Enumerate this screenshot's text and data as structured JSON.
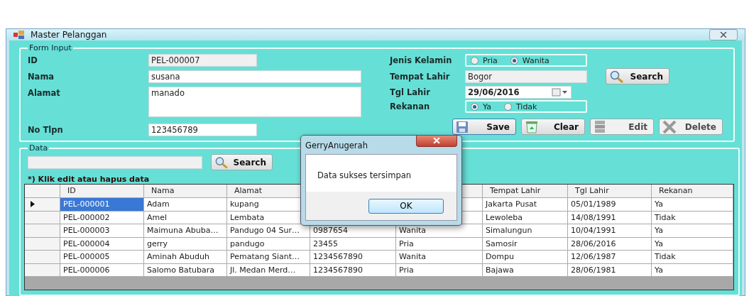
{
  "window": {
    "title": "Master Pelanggan"
  },
  "form_input": {
    "title": "Form Input",
    "left_fields": [
      {
        "label": "ID",
        "value": "PEL-000007",
        "kind": "readonly"
      },
      {
        "label": "Nama",
        "value": "susana",
        "kind": "text"
      },
      {
        "label": "Alamat",
        "value": "manado",
        "kind": "multiline"
      },
      {
        "label": "No Tlpn",
        "value": "123456789",
        "kind": "short"
      }
    ],
    "right_fields": [
      {
        "label": "Jenis Kelamin",
        "kind": "radio",
        "options": [
          {
            "label": "Pria",
            "selected": false
          },
          {
            "label": "Wanita",
            "selected": true
          }
        ]
      },
      {
        "label": "Tempat Lahir",
        "kind": "readonly",
        "value": "Bogor"
      },
      {
        "label": "Tgl Lahir",
        "kind": "date",
        "value": "29/06/2016"
      },
      {
        "label": "Rekanan",
        "kind": "radio",
        "options": [
          {
            "label": "Ya",
            "selected": true
          },
          {
            "label": "Tidak",
            "selected": false
          }
        ]
      }
    ],
    "search_button": "Search",
    "buttons": [
      {
        "label": "Save",
        "kind": "save",
        "disabled": false
      },
      {
        "label": "Clear",
        "kind": "clear",
        "disabled": false
      },
      {
        "label": "Edit",
        "kind": "edit",
        "disabled": true
      },
      {
        "label": "Delete",
        "kind": "delete",
        "disabled": true
      }
    ]
  },
  "data": {
    "title": "Data",
    "search_button": "Search",
    "note": "*) Klik edit atau hapus data",
    "table": {
      "columns": [
        "ID",
        "Nama",
        "Alamat",
        null,
        null,
        "Tempat Lahir",
        "Tgl Lahir",
        "Rekanan"
      ],
      "rows": [
        {
          "selected": true,
          "cells": [
            "PEL-000001",
            "Adam",
            "kupang",
            null,
            null,
            "Jakarta Pusat",
            "05/01/1989",
            "Ya"
          ]
        },
        {
          "selected": false,
          "cells": [
            "PEL-000002",
            "Amel",
            "Lembata",
            null,
            null,
            "Lewoleba",
            "14/08/1991",
            "Tidak"
          ]
        },
        {
          "selected": false,
          "cells": [
            "PEL-000003",
            "Maimuna Abuba…",
            "Pandugo 04 Sur…",
            "0987654",
            "Wanita",
            "Simalungun",
            "10/04/1991",
            "Ya"
          ]
        },
        {
          "selected": false,
          "cells": [
            "PEL-000004",
            "gerry",
            "pandugo",
            "23455",
            "Pria",
            "Samosir",
            "28/06/2016",
            "Ya"
          ]
        },
        {
          "selected": false,
          "cells": [
            "PEL-000005",
            "Aminah Abuduh",
            "Pematang Siant…",
            "1234567890",
            "Wanita",
            "Dompu",
            "12/06/1987",
            "Tidak"
          ]
        },
        {
          "selected": false,
          "cells": [
            "PEL-000006",
            "Salomo Batubara",
            "Jl. Medan Merd…",
            "1234567890",
            "Pria",
            "Bajawa",
            "28/06/1981",
            "Ya"
          ]
        }
      ]
    }
  },
  "dialog": {
    "title": "GerryAnugerah",
    "message": "Data sukses tersimpan",
    "button": "OK"
  }
}
